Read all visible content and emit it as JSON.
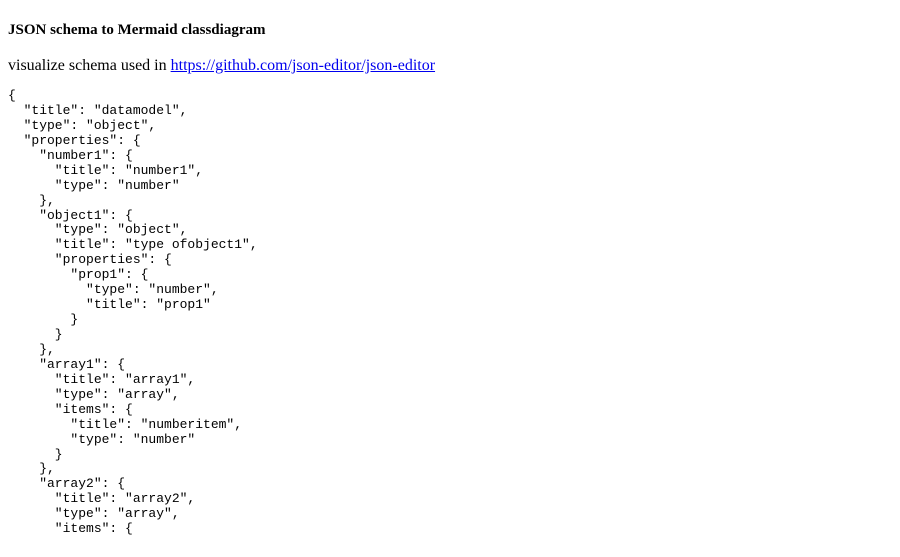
{
  "heading": "JSON schema to Mermaid classdiagram",
  "intro_prefix": "visualize schema used in ",
  "intro_link_text": "https://github.com/json-editor/json-editor",
  "intro_link_href": "https://github.com/json-editor/json-editor",
  "code": "{\n  \"title\": \"datamodel\",\n  \"type\": \"object\",\n  \"properties\": {\n    \"number1\": {\n      \"title\": \"number1\",\n      \"type\": \"number\"\n    },\n    \"object1\": {\n      \"type\": \"object\",\n      \"title\": \"type ofobject1\",\n      \"properties\": {\n        \"prop1\": {\n          \"type\": \"number\",\n          \"title\": \"prop1\"\n        }\n      }\n    },\n    \"array1\": {\n      \"title\": \"array1\",\n      \"type\": \"array\",\n      \"items\": {\n        \"title\": \"numberitem\",\n        \"type\": \"number\"\n      }\n    },\n    \"array2\": {\n      \"title\": \"array2\",\n      \"type\": \"array\",\n      \"items\": {"
}
